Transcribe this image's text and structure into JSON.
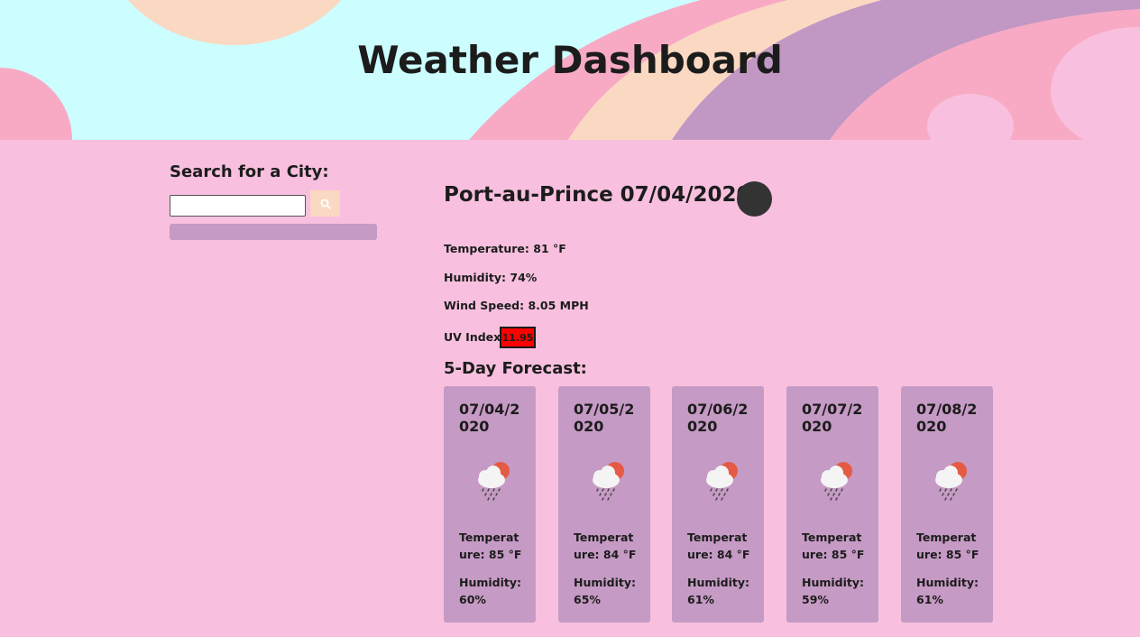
{
  "header": {
    "title": "Weather Dashboard"
  },
  "search": {
    "heading": "Search for a City:",
    "input_value": "",
    "placeholder": "",
    "button_icon": "search-icon"
  },
  "current": {
    "city_date": "Port-au-Prince 07/04/2020",
    "temperature": "Temperature: 81 °F",
    "humidity": "Humidity: 74%",
    "wind": "Wind Speed: 8.05 MPH",
    "uv_label": "UV Index:",
    "uv_value": "11.95",
    "uv_color": "#ff0000"
  },
  "forecast": {
    "heading": "5-Day Forecast:",
    "days": [
      {
        "date": "07/04/2020",
        "icon": "rain-cloud-sun-icon",
        "temp": "Temperature: 85 °F",
        "humidity": "Humidity: 60%"
      },
      {
        "date": "07/05/2020",
        "icon": "rain-cloud-sun-icon",
        "temp": "Temperature: 84 °F",
        "humidity": "Humidity: 65%"
      },
      {
        "date": "07/06/2020",
        "icon": "rain-cloud-sun-icon",
        "temp": "Temperature: 84 °F",
        "humidity": "Humidity: 61%"
      },
      {
        "date": "07/07/2020",
        "icon": "rain-cloud-sun-icon",
        "temp": "Temperature: 85 °F",
        "humidity": "Humidity: 59%"
      },
      {
        "date": "07/08/2020",
        "icon": "rain-cloud-sun-icon",
        "temp": "Temperature: 85 °F",
        "humidity": "Humidity: 61%"
      }
    ]
  },
  "colors": {
    "background": "#f8c0de",
    "card": "#c59ac4",
    "search_button": "#fbd8c2",
    "banner_cyan": "#ccfeff",
    "banner_peach": "#fbd8c2",
    "banner_pink": "#f8aac4",
    "banner_purple": "#c197c3"
  }
}
